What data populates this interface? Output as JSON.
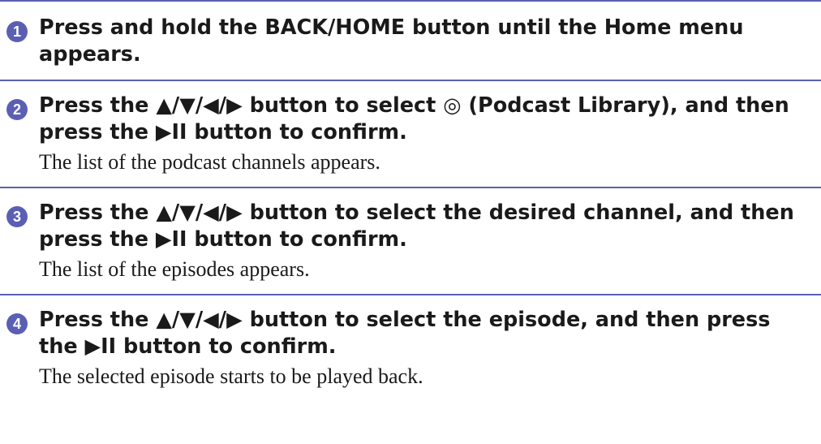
{
  "steps": [
    {
      "number": "1",
      "instruction": "Press and hold the BACK/HOME button until the Home menu appears.",
      "result": ""
    },
    {
      "number": "2",
      "instruction_parts": [
        "Press the ",
        "▲/▼/◀/▶",
        " button to select ",
        "◎",
        " (Podcast Library), and then press the ",
        "▶II",
        " button to confirm."
      ],
      "result": "The list of the podcast channels appears."
    },
    {
      "number": "3",
      "instruction_parts": [
        "Press the ",
        "▲/▼/◀/▶",
        " button to select the desired channel, and then press the ",
        "▶II",
        " button to confirm."
      ],
      "result": "The list of the episodes appears."
    },
    {
      "number": "4",
      "instruction_parts": [
        "Press the ",
        "▲/▼/◀/▶",
        " button to select the episode, and then press the ",
        "▶II",
        " button to confirm."
      ],
      "result": "The selected episode starts to be played back."
    }
  ],
  "colors": {
    "accent": "#5b5fb4",
    "text": "#1a1a1a"
  }
}
